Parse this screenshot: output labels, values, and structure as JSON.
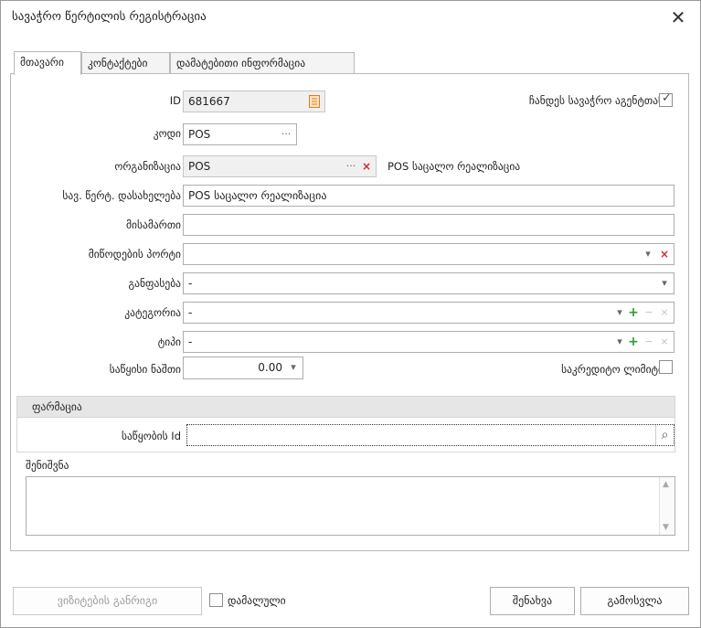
{
  "window": {
    "title": "სავაჭრო წერტილის რეგისტრაცია",
    "close_icon": "✕"
  },
  "tabs": [
    {
      "label": "მთავარი",
      "active": true
    },
    {
      "label": "კონტაქტები",
      "active": false
    },
    {
      "label": "დამატებითი ინფორმაცია",
      "active": false
    }
  ],
  "form": {
    "id": {
      "label": "ID",
      "value": "681667"
    },
    "show_agent": {
      "label": "ჩანდეს სავაჭრო აგენტთან",
      "checked": true
    },
    "code": {
      "label": "კოდი",
      "value": "POS"
    },
    "organization": {
      "label": "ორგანიზაცია",
      "value": "POS",
      "display_name": "POS საცალო რეალიზაცია"
    },
    "point_name": {
      "label": "სავ. წერტ. დასახელება",
      "value": "POS საცალო რეალიზაცია"
    },
    "address": {
      "label": "მისამართი",
      "value": ""
    },
    "delivery_port": {
      "label": "მიწოდების პორტი",
      "value": ""
    },
    "discount": {
      "label": "განფასება",
      "value": "-"
    },
    "category": {
      "label": "კატეგორია",
      "value": "-"
    },
    "type": {
      "label": "ტიპი",
      "value": "-"
    },
    "initial_balance": {
      "label": "საწყისი ნაშთი",
      "value": "0.00"
    },
    "credit_limit": {
      "label": "საკრედიტო ლიმიტი",
      "checked": false
    },
    "pharmacy": {
      "header": "ფარმაცია",
      "warehouse_label": "საწყობის Id",
      "warehouse_value": ""
    },
    "notes": {
      "label": "შენიშვნა",
      "value": ""
    }
  },
  "footer": {
    "visit_schedule_label": "ვიზიტების განრიგი",
    "hidden_label": "დამალული",
    "hidden_checked": false,
    "save_label": "შენახვა",
    "exit_label": "გამოსვლა"
  },
  "glyphs": {
    "ellipsis": "···",
    "clear": "×",
    "dropdown": "▾",
    "plus": "+",
    "minus": "−",
    "check": "✓",
    "search": "⌕",
    "scroll_up": "▲",
    "scroll_down": "▼"
  }
}
